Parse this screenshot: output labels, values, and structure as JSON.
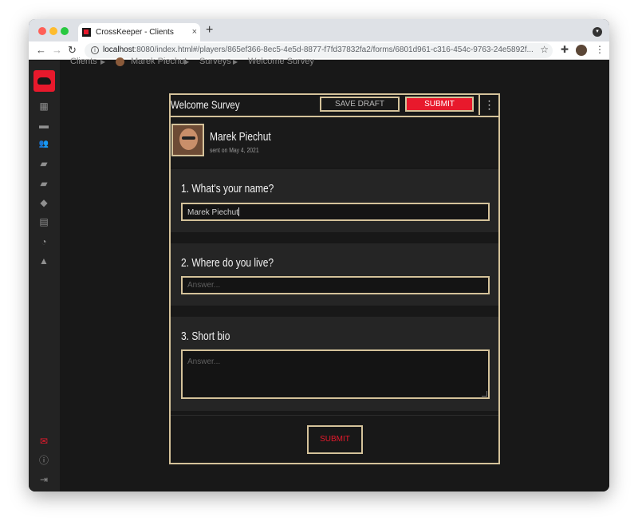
{
  "browser": {
    "tab_title": "CrossKeeper - Clients",
    "tab_close": "×",
    "new_tab": "+",
    "url_host": "localhost",
    "url_rest": ":8080/index.html#/players/865ef366-8ec5-4e5d-8877-f7fd37832fa2/forms/6801d961-c316-454c-9763-24e5892f...",
    "back": "←",
    "forward": "→",
    "reload": "↻",
    "star": "☆",
    "extensions": "✚",
    "menu": "⋮",
    "info": "i"
  },
  "breadcrumb": {
    "items": [
      "Clients",
      "Marek Piechut",
      "Surveys",
      "Welcome Survey"
    ],
    "separator": "▶"
  },
  "sidebar": {
    "icons": [
      {
        "name": "dashboard-icon",
        "glyph": "▦"
      },
      {
        "name": "calendar-icon",
        "glyph": "▬"
      },
      {
        "name": "clients-icon",
        "glyph": "👥"
      },
      {
        "name": "chat-icon",
        "glyph": "▰"
      },
      {
        "name": "folder-icon",
        "glyph": "▰"
      },
      {
        "name": "education-icon",
        "glyph": "◆"
      },
      {
        "name": "document-icon",
        "glyph": "▤"
      },
      {
        "name": "progress-icon",
        "glyph": "◔"
      },
      {
        "name": "bell-icon",
        "glyph": "▲"
      },
      {
        "name": "mail-icon",
        "glyph": "✉"
      },
      {
        "name": "info-icon",
        "glyph": "ⓘ"
      },
      {
        "name": "logout-icon",
        "glyph": "⇥"
      }
    ]
  },
  "form": {
    "title": "Welcome Survey",
    "save_draft_label": "SAVE DRAFT",
    "submit_label": "SUBMIT",
    "more_label": "⋮",
    "author_name": "Marek Piechut",
    "sent_text": "sent on May 4, 2021",
    "questions": [
      {
        "label": "1. What's your name?",
        "value": "Marek Piechut",
        "placeholder": "Answer..."
      },
      {
        "label": "2. Where do you live?",
        "value": "",
        "placeholder": "Answer..."
      },
      {
        "label": "3. Short bio",
        "value": "",
        "placeholder": "Answer..."
      }
    ],
    "submit_bottom_label": "SUBMIT"
  },
  "colors": {
    "accent": "#e8192c",
    "border": "#d4c29a",
    "background": "#181818"
  }
}
